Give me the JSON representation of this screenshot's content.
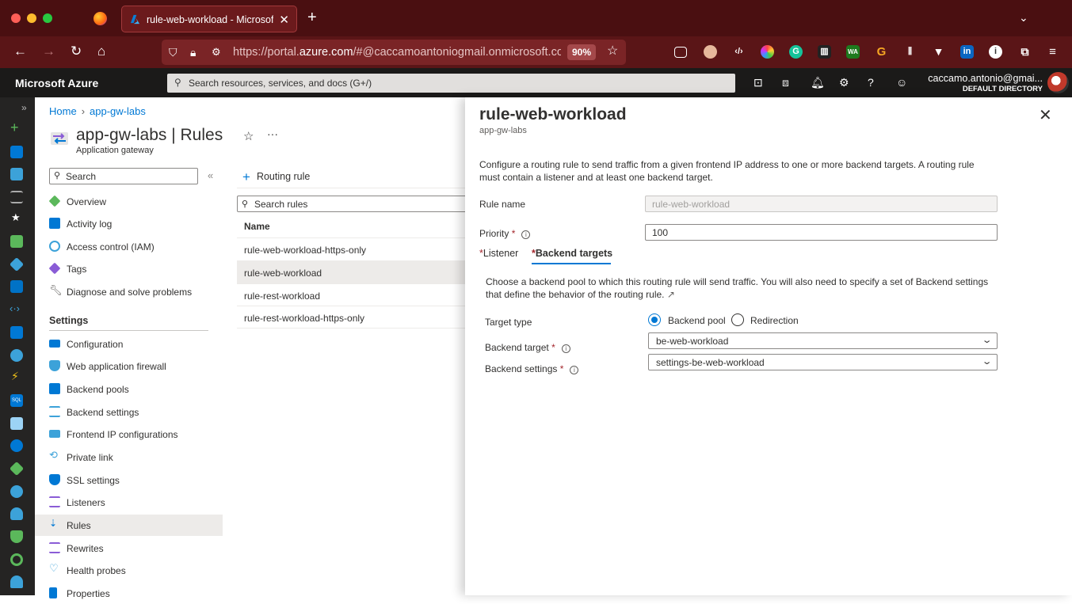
{
  "browser": {
    "tab_title": "rule-web-workload - Microsoft Azure",
    "url_prefix": "https://portal.",
    "url_domain": "azure.com",
    "url_suffix": "/#@caccamoantoniogmail.onmicrosoft.com",
    "zoom": "90%",
    "new_tab": "+",
    "tab_close": "✕"
  },
  "azure": {
    "brand": "Microsoft Azure",
    "search_placeholder": "Search resources, services, and docs (G+/)",
    "user_name": "caccamo.antonio@gmai...",
    "user_directory": "DEFAULT DIRECTORY"
  },
  "breadcrumb": [
    "Home",
    "app-gw-labs"
  ],
  "resource": {
    "title": "app-gw-labs | Rules",
    "subtitle": "Application gateway",
    "more": "···"
  },
  "menu": {
    "search": "Search",
    "collapse": "«",
    "items_top": [
      "Overview",
      "Activity log",
      "Access control (IAM)",
      "Tags",
      "Diagnose and solve problems"
    ],
    "section": "Settings",
    "items_settings": [
      "Configuration",
      "Web application firewall",
      "Backend pools",
      "Backend settings",
      "Frontend IP configurations",
      "Private link",
      "SSL settings",
      "Listeners",
      "Rules",
      "Rewrites",
      "Health probes",
      "Properties"
    ]
  },
  "rules": {
    "add_label": "Routing rule",
    "search_placeholder": "Search rules",
    "column_name": "Name",
    "rows": [
      "rule-web-workload-https-only",
      "rule-web-workload",
      "rule-rest-workload",
      "rule-rest-workload-https-only"
    ]
  },
  "panel": {
    "title": "rule-web-workload",
    "subtitle": "app-gw-labs",
    "close": "✕",
    "description": "Configure a routing rule to send traffic from a given frontend IP address to one or more backend targets. A routing rule must contain a listener and at least one backend target.",
    "rule_name_label": "Rule name",
    "rule_name_value": "rule-web-workload",
    "priority_label": "Priority",
    "priority_value": "100",
    "tab_listener": "Listener",
    "tab_backend": "Backend targets",
    "backend_desc": "Choose a backend pool to which this routing rule will send traffic. You will also need to specify a set of Backend settings that define the behavior of the routing rule.",
    "target_type_label": "Target type",
    "option_pool": "Backend pool",
    "option_redirect": "Redirection",
    "backend_target_label": "Backend target",
    "backend_target_value": "be-web-workload",
    "backend_settings_label": "Backend settings",
    "backend_settings_value": "settings-be-web-workload",
    "required_mark": "*"
  },
  "colors": {
    "azure_blue": "#0078d4",
    "browser_dark": "#4a0f11",
    "browser_nav": "#5a1517",
    "portal_header": "#1b1a19",
    "required": "#a4262c"
  }
}
